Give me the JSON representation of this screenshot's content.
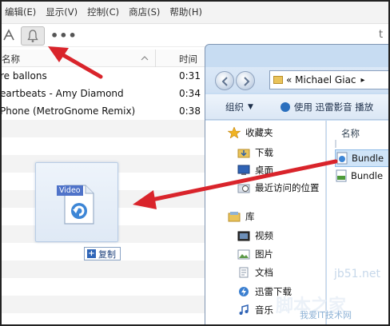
{
  "menubar": {
    "items": [
      "编辑(E)",
      "显示(V)",
      "控制(C)",
      "商店(S)",
      "帮助(H)"
    ]
  },
  "toolbar": {
    "tool_icon": "tools-icon",
    "bell_icon": "bell-icon",
    "more_label": "•••",
    "right_label": "t"
  },
  "track_list": {
    "header_name": "名称",
    "header_time": "时间",
    "rows": [
      {
        "title": "re ballons",
        "time": "0:31"
      },
      {
        "title": "eartbeats - Amy Diamond",
        "time": "0:34"
      },
      {
        "title": "Phone (MetroGnome Remix)",
        "time": "0:38"
      }
    ]
  },
  "drag": {
    "file_label": "Video",
    "copy_label": "复制"
  },
  "explorer": {
    "address": "«  Michael Giac",
    "address_arrow": "▸",
    "organize_label": "组织",
    "play_label": "使用 迅雷影音 播放",
    "nav_items": [
      {
        "label": "收藏夹",
        "icon": "star-icon"
      },
      {
        "label": "下载",
        "icon": "download-folder-icon"
      },
      {
        "label": "桌面",
        "icon": "desktop-icon"
      },
      {
        "label": "最近访问的位置",
        "icon": "recent-places-icon"
      },
      {
        "label": "库",
        "icon": "library-icon"
      },
      {
        "label": "视频",
        "icon": "video-library-icon"
      },
      {
        "label": "图片",
        "icon": "pictures-library-icon"
      },
      {
        "label": "文档",
        "icon": "documents-library-icon"
      },
      {
        "label": "迅雷下载",
        "icon": "thunder-download-icon"
      },
      {
        "label": "音乐",
        "icon": "music-library-icon"
      }
    ],
    "column_name": "名称",
    "files": [
      {
        "label": "Bundle",
        "icon": "video-file-icon",
        "selected": true
      },
      {
        "label": "Bundle",
        "icon": "mp3-file-icon",
        "selected": false
      }
    ]
  },
  "watermark": {
    "url": "jb51.net",
    "brand": "脚本之家",
    "site": "我爱IT技术网"
  },
  "colors": {
    "arrow_red": "#d9242b",
    "selection_blue": "#cfe4f8",
    "explorer_frame": "#c7dcf2"
  }
}
